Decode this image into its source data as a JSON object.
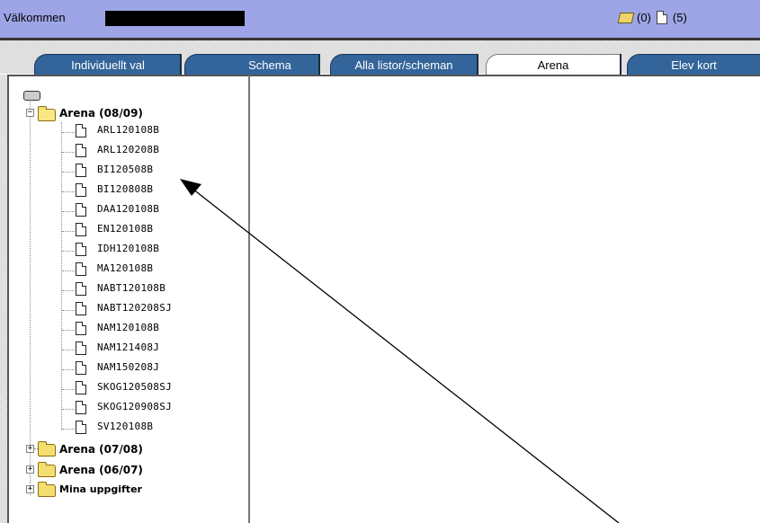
{
  "header": {
    "welcome": "Välkommen",
    "mail_count": "(0)",
    "doc_count": "(5)"
  },
  "tabs": [
    {
      "label": "Individuellt val",
      "active": false
    },
    {
      "label": "Schema",
      "active": false
    },
    {
      "label": "Alla listor/scheman",
      "active": false
    },
    {
      "label": "Arena",
      "active": true
    },
    {
      "label": "Elev kort",
      "active": false
    }
  ],
  "tree": {
    "root_icon": "drive-icon",
    "expanded_folder": {
      "label": "Arena (08/09)",
      "expander": "−",
      "files": [
        "ARL120108B",
        "ARL120208B",
        "BI120508B",
        "BI120808B",
        "DAA120108B",
        "EN120108B",
        "IDH120108B",
        "MA120108B",
        "NABT120108B",
        "NABT120208SJ",
        "NAM120108B",
        "NAM121408J",
        "NAM150208J",
        "SKOG120508SJ",
        "SKOG120908SJ",
        "SV120108B"
      ]
    },
    "collapsed_folders": [
      {
        "label": "Arena (07/08)",
        "expander": "+"
      },
      {
        "label": "Arena (06/07)",
        "expander": "+"
      },
      {
        "label": "Mina uppgifter",
        "expander": "+"
      }
    ]
  },
  "annotation": {
    "type": "arrow",
    "color": "#000000",
    "pointing_to": "BI120508B"
  }
}
